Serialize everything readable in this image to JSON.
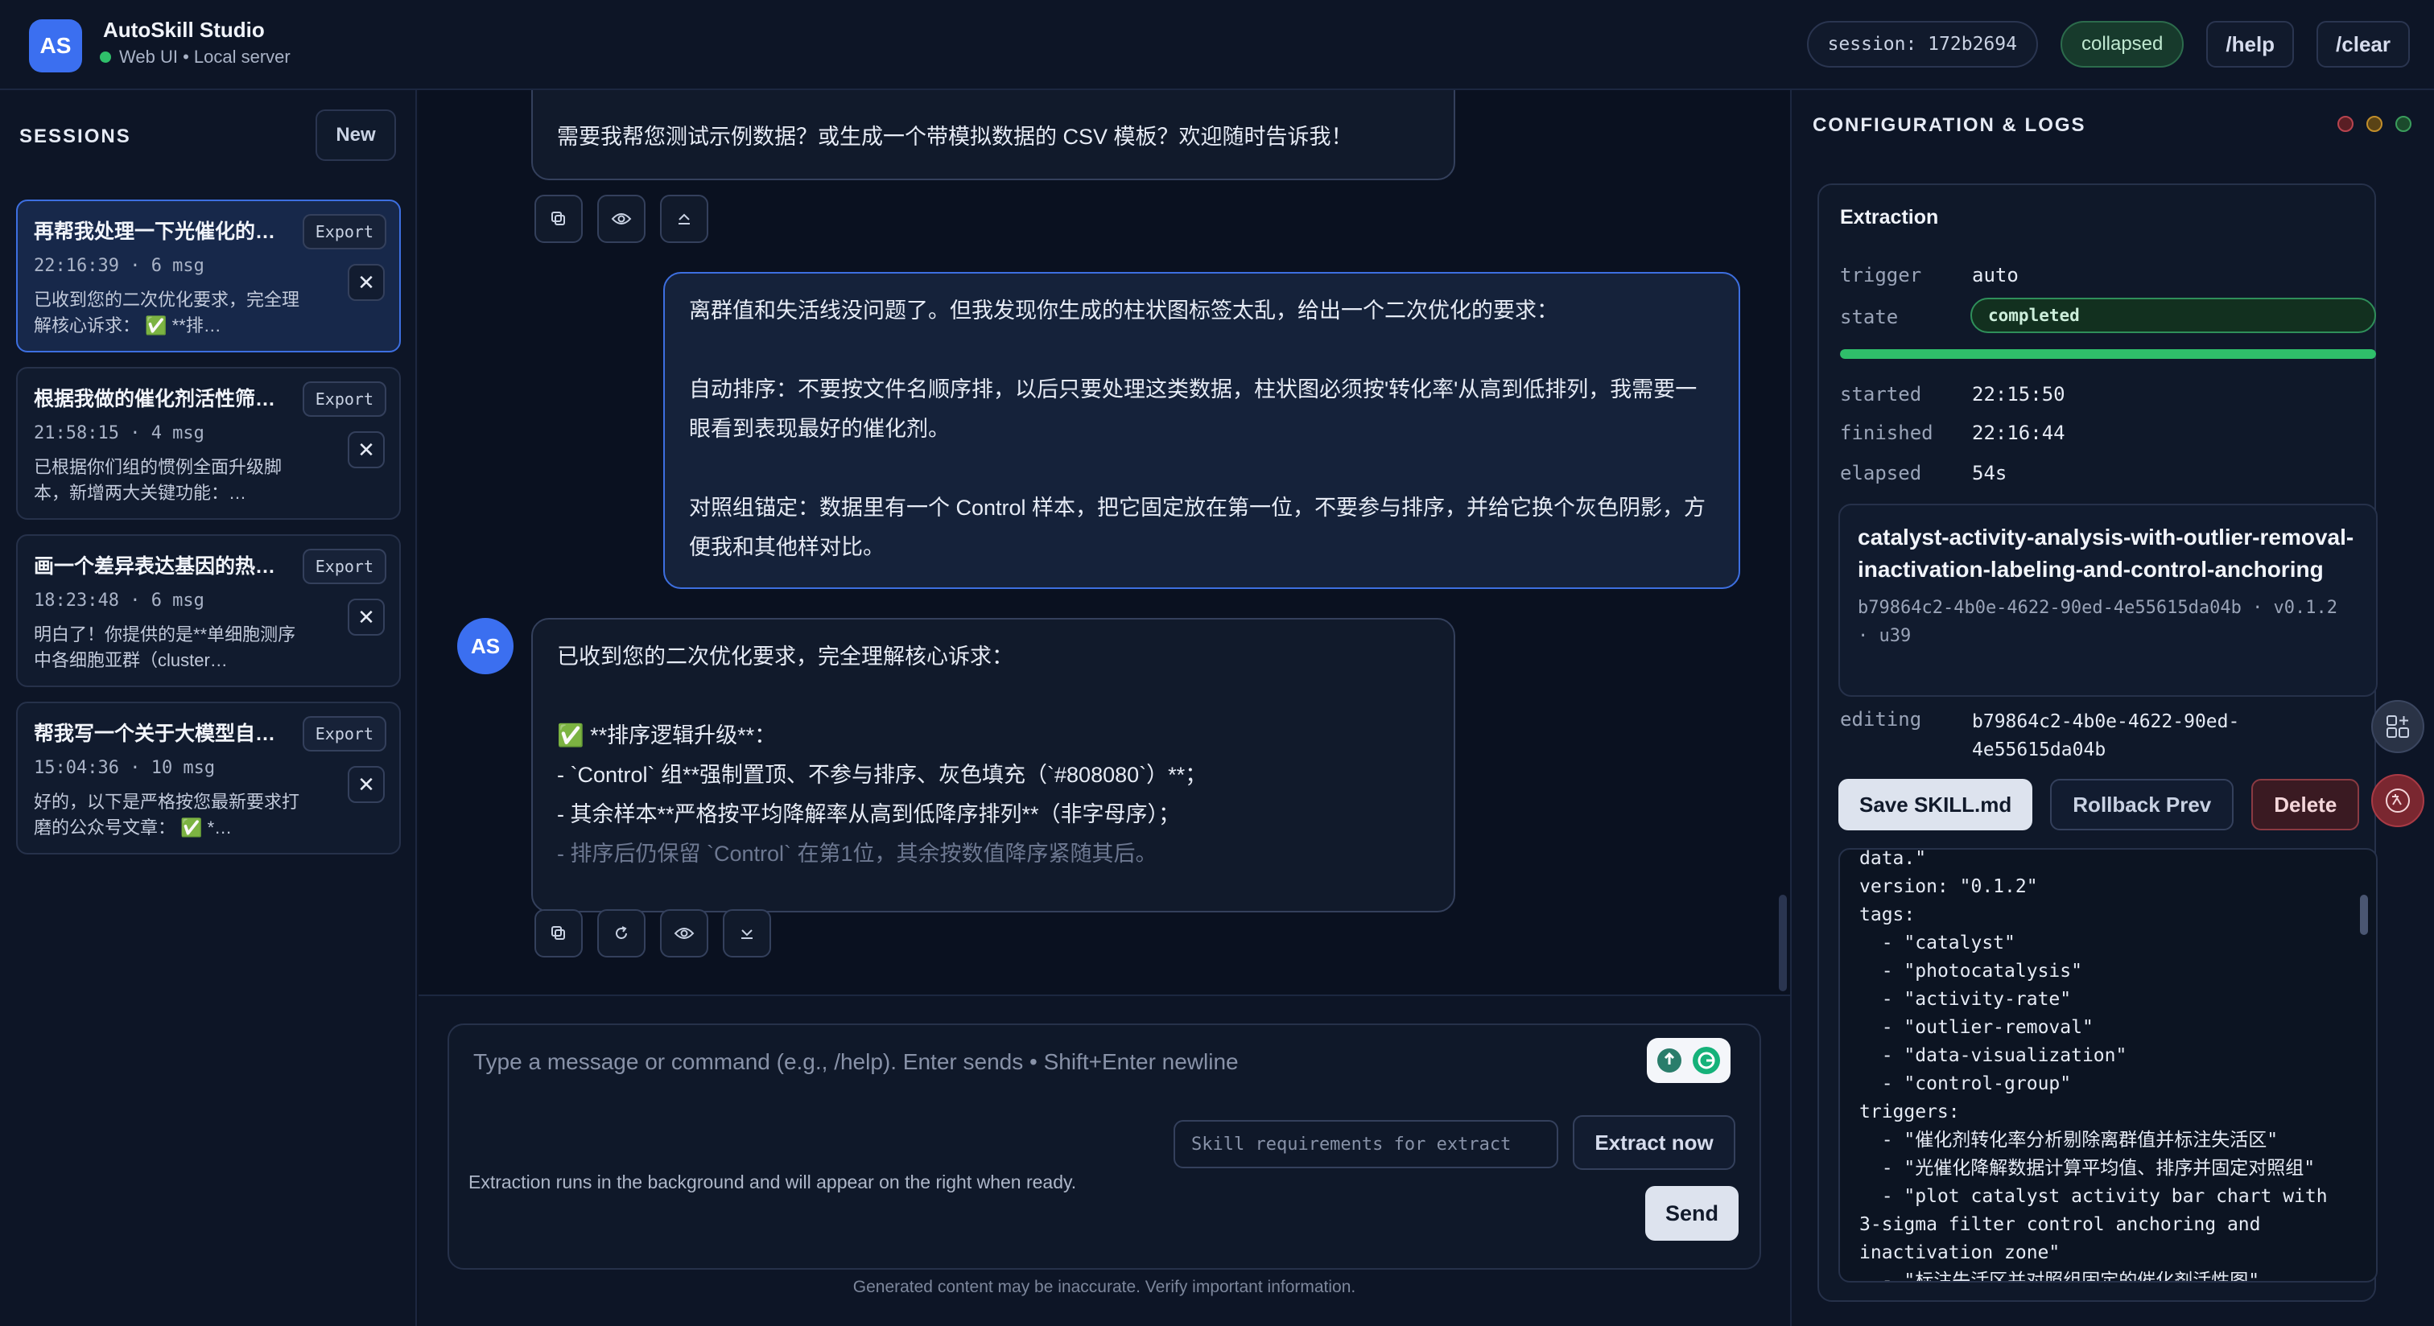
{
  "app": {
    "logo": "AS",
    "title": "AutoSkill Studio",
    "subtitle": "Web UI • Local server"
  },
  "header": {
    "session": "session: 172b2694",
    "mode": "collapsed",
    "help": "/help",
    "clear": "/clear"
  },
  "sidebar": {
    "title": "SESSIONS",
    "new_label": "New",
    "export_label": "Export",
    "sessions": [
      {
        "title": "再帮我处理一下光催化的数据…",
        "meta": "22:16:39 · 6 msg",
        "preview": "已收到您的二次优化要求，完全理解核心诉求： ✅ **排…"
      },
      {
        "title": "根据我做的催化剂活性筛选数据…",
        "meta": "21:58:15 · 4 msg",
        "preview": "已根据你们组的惯例全面升级脚本，新增两大关键功能：…"
      },
      {
        "title": "画一个差异表达基因的热图…",
        "meta": "18:23:48 · 6 msg",
        "preview": "明白了！你提供的是**单细胞测序中各细胞亚群（cluster…"
      },
      {
        "title": "帮我写一个关于大模型自进化…",
        "meta": "15:04:36 · 10 msg",
        "preview": "好的，以下是严格按您最新要求打磨的公众号文章： ✅ *…"
      }
    ]
  },
  "chat": {
    "msg1_last_line": "需要我帮您测试示例数据？或生成一个带模拟数据的 CSV 模板？欢迎随时告诉我！",
    "user_msg": {
      "p1": "离群值和失活线没问题了。但我发现你生成的柱状图标签太乱，给出一个二次优化的要求：",
      "p2": "自动排序：不要按文件名顺序排，以后只要处理这类数据，柱状图必须按'转化率'从高到低排列，我需要一眼看到表现最好的催化剂。",
      "p3": "对照组锚定：数据里有一个 Control 样本，把它固定放在第一位，不要参与排序，并给它换个灰色阴影，方便我和其他样对比。"
    },
    "assistant_avatar": "AS",
    "assistant_msg": {
      "l1": "已收到您的二次优化要求，完全理解核心诉求：",
      "l2": "✅ **排序逻辑升级**：",
      "l3": "- `Control` 组**强制置顶、不参与排序、灰色填充（`#808080`）**；",
      "l4": "- 其余样本**严格按平均降解率从高到低降序排列**（非字母序）；",
      "l5": "- 排序后仍保留 `Control` 在第1位，其余按数值降序紧随其后。"
    }
  },
  "composer": {
    "placeholder": "Type a message or command (e.g., /help). Enter sends • Shift+Enter newline",
    "note": "Extraction runs in the background and will appear on the right when ready.",
    "skill_placeholder": "Skill requirements for extract",
    "extract_label": "Extract now",
    "send_label": "Send",
    "disclaimer": "Generated content may be inaccurate. Verify important information."
  },
  "panel": {
    "title": "CONFIGURATION & LOGS",
    "extraction": {
      "title": "Extraction",
      "trigger_key": "trigger",
      "trigger_val": "auto",
      "state_key": "state",
      "state_val": "completed",
      "progress": 1.0,
      "started_key": "started",
      "started_val": "22:15:50",
      "finished_key": "finished",
      "finished_val": "22:16:44",
      "elapsed_key": "elapsed",
      "elapsed_val": "54s"
    },
    "skill": {
      "name": "catalyst-activity-analysis-with-outlier-removal-inactivation-labeling-and-control-anchoring",
      "version_line": "b79864c2-4b0e-4622-90ed-4e55615da04b · v0.1.2 · u39"
    },
    "editing_key": "editing",
    "editing_val": "b79864c2-4b0e-4622-90ed-4e55615da04b",
    "save_label": "Save SKILL.md",
    "rollback_label": "Rollback Prev",
    "delete_label": "Delete",
    "code": "data.\"\nversion: \"0.1.2\"\ntags:\n  - \"catalyst\"\n  - \"photocatalysis\"\n  - \"activity-rate\"\n  - \"outlier-removal\"\n  - \"data-visualization\"\n  - \"control-group\"\ntriggers:\n  - \"催化剂转化率分析剔除离群值并标注失活区\"\n  - \"光催化降解数据计算平均值、排序并固定对照组\"\n  - \"plot catalyst activity bar chart with 3-sigma filter control anchoring and inactivation zone\"\n  - \"标注失活区并对照组固定的催化剂活性图\""
  },
  "colors": {
    "accent": "#3b6ff0",
    "success": "#2fbf6a",
    "danger": "#8a3a42",
    "background": "#0c1322"
  }
}
